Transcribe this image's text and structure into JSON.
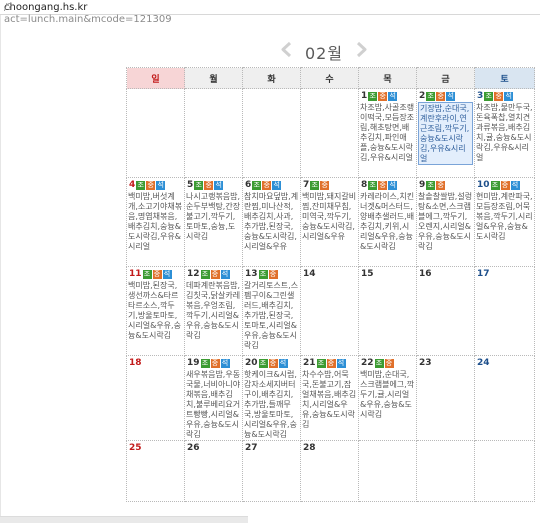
{
  "address_bar": {
    "host": "choongang.hs.kr",
    "rest": "/?act=lunch.main&mcode=121309"
  },
  "month": {
    "title": "02월",
    "prev_icon": "chevron-left-icon",
    "next_icon": "chevron-right-icon"
  },
  "weekdays": [
    "일",
    "월",
    "화",
    "수",
    "목",
    "금",
    "토"
  ],
  "meal_badges": {
    "b": "조",
    "l": "중",
    "d": "석"
  },
  "colors": {
    "sunday": "#c21a1a",
    "saturday": "#1d4f8b",
    "breakfast": "#3c9b32",
    "lunch": "#e0702b",
    "dinner": "#2d8fd5"
  },
  "weeks": [
    [
      {
        "day": "",
        "meals": "",
        "menu": ""
      },
      {
        "day": "",
        "meals": "",
        "menu": ""
      },
      {
        "day": "",
        "meals": "",
        "menu": ""
      },
      {
        "day": "",
        "meals": "",
        "menu": ""
      },
      {
        "day": "1",
        "meals": "bld",
        "menu": "차조밥,사골조랭이떡국,모듬장조림,해초탕면,배추김치,파인애플,숭늉&도시락김,우유&시리얼"
      },
      {
        "day": "2",
        "meals": "bld",
        "menu": "기장밥,순대국,계란후라이,연근조림,깍두기,숭늉&도시락김,우유&시리얼",
        "selected": true
      },
      {
        "day": "3",
        "meals": "bld",
        "menu": "차조밥,물만두국,돈육폭찹,열치견과류볶음,배추김치,귤,숭늉&도시락김,우유&시리얼"
      }
    ],
    [
      {
        "day": "4",
        "meals": "bld",
        "menu": "백미밥,버섯계개,소고기야채볶음,명엽채볶음,배추김치,숭늉&도시락김,우유&시리얼"
      },
      {
        "day": "5",
        "meals": "bld",
        "menu": "나시고랭볶음밥,순두부백탕,간장불고기,깍두기,토마토,숭늉,도시락김"
      },
      {
        "day": "6",
        "meals": "bld",
        "menu": "참치마요덮밥,계란찜,미나산적,배추김치,사과,추가밥,된장국,숭늉&도시락김,시리얼&우유"
      },
      {
        "day": "7",
        "meals": "bl",
        "menu": "백미밥,돼지갈비찜,잔미채무침,미역국,깍두기,숭늉&도시락김,시리얼&우유"
      },
      {
        "day": "8",
        "meals": "bld",
        "menu": "카레라이스,치킨너겟&머스터드,양배추샐러드,배추김치,키위,시리얼&우유,숭늉&도시락김"
      },
      {
        "day": "9",
        "meals": "bl",
        "menu": "찰솥찰쌀밥,설렁탕&소면,스크램블에그,깍두기,오렌지,시리얼&우유,숭늉&도시락김"
      },
      {
        "day": "10",
        "meals": "bld",
        "menu": "현미밥,계란파국,모듬장조림,어묵볶음,깍두기,시리얼&우유,숭늉&도시락김"
      }
    ],
    [
      {
        "day": "11",
        "meals": "bld",
        "menu": "백미밥,된장국,생선까스&타르타르소스,깍두기,방울토마토,시리얼&우유,숭늉&도시락김"
      },
      {
        "day": "12",
        "meals": "bld",
        "menu": "데파계란볶음밥,김칫국,닭살카레볶음,우엉조림,깍두기,시리얼&우유,숭늉&도시락김"
      },
      {
        "day": "13",
        "meals": "bl",
        "menu": "갈거리토스트,스펨구이&그린샐러드,배추김치,추가밥,된장국,토마토,시리얼&우유,숭늉&도시락김"
      },
      {
        "day": "14",
        "meals": "",
        "menu": ""
      },
      {
        "day": "15",
        "meals": "",
        "menu": ""
      },
      {
        "day": "16",
        "meals": "",
        "menu": ""
      },
      {
        "day": "17",
        "meals": "",
        "menu": ""
      }
    ],
    [
      {
        "day": "18",
        "meals": "",
        "menu": ""
      },
      {
        "day": "19",
        "meals": "bld",
        "menu": "새우볶음밥,우동국물,너비아니야채볶음,배추김치,불루베리요거트빵빵,시리얼&우유,숭늉&도시락김"
      },
      {
        "day": "20",
        "meals": "bld",
        "menu": "핫케이크&시럽,감자소세지버터구이,배추김치,추가밥,들깨무국,방울토마토,시리얼&우유,숭늉&도시락김"
      },
      {
        "day": "21",
        "meals": "bld",
        "menu": "차수수밥,어묵국,돈불고기,잡얼채볶음,배추김치,시리얼&우유,숭늉&도시락김"
      },
      {
        "day": "22",
        "meals": "bl",
        "menu": "백미밥,순대국,스크램블에그,깍두기,귤,시리얼&우유,숭늉&도시락김"
      },
      {
        "day": "23",
        "meals": "",
        "menu": ""
      },
      {
        "day": "24",
        "meals": "",
        "menu": ""
      }
    ],
    [
      {
        "day": "25",
        "meals": "",
        "menu": ""
      },
      {
        "day": "26",
        "meals": "",
        "menu": ""
      },
      {
        "day": "27",
        "meals": "",
        "menu": ""
      },
      {
        "day": "28",
        "meals": "",
        "menu": ""
      },
      {
        "day": "",
        "meals": "",
        "menu": ""
      },
      {
        "day": "",
        "meals": "",
        "menu": ""
      },
      {
        "day": "",
        "meals": "",
        "menu": ""
      }
    ]
  ]
}
